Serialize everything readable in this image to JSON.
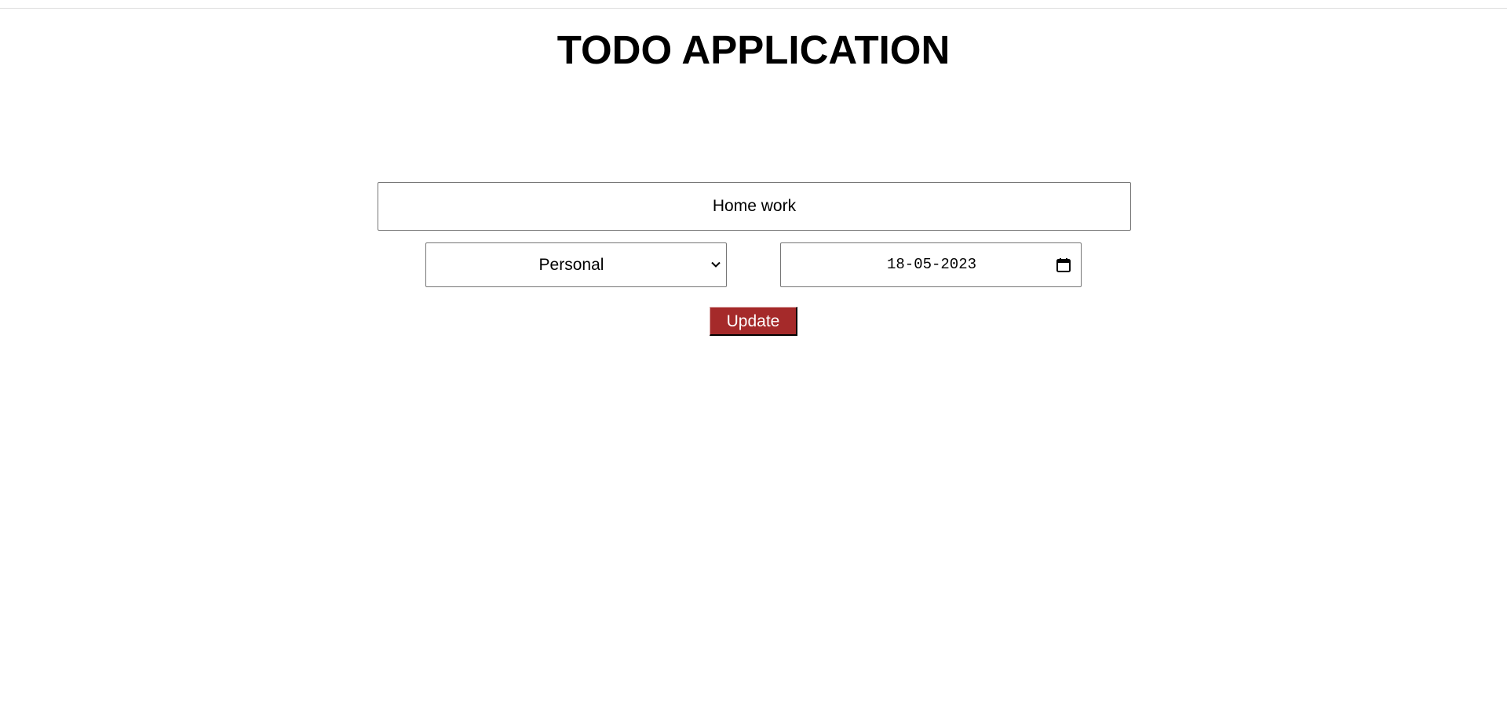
{
  "header": {
    "title": "TODO APPLICATION"
  },
  "form": {
    "task_value": "Home work",
    "category_selected": "Personal",
    "date_value": "18-05-2023",
    "update_label": "Update"
  },
  "icons": {
    "dropdown": "chevron-down-icon",
    "date": "calendar-icon"
  },
  "colors": {
    "update_button_bg": "#a52a2a",
    "update_button_text": "#ffffff"
  }
}
